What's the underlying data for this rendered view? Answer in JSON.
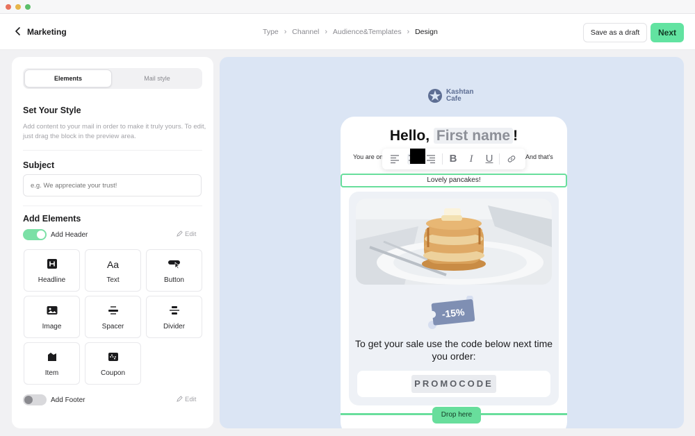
{
  "app": {
    "title": "Marketing"
  },
  "breadcrumb": {
    "items": [
      "Type",
      "Channel",
      "Audience&Templates",
      "Design"
    ],
    "active_index": 3
  },
  "toolbar": {
    "save_draft_label": "Save as a draft",
    "next_label": "Next"
  },
  "colors": {
    "accent": "#62e3a1",
    "preview_bg": "#dbe5f4",
    "logo": "#5d6e93",
    "coupon": "#7f8fb3"
  },
  "left_panel": {
    "tabs": [
      {
        "label": "Elements",
        "active": true
      },
      {
        "label": "Mail style",
        "active": false
      }
    ],
    "style_title": "Set Your Style",
    "style_desc": "Add content to your mail in order to make it truly yours. To edit, just drag the block in the preview area.",
    "subject_title": "Subject",
    "subject_placeholder": "e.g. We appreciate your trust!",
    "subject_value": "",
    "elements_title": "Add Elements",
    "header_toggle": {
      "label": "Add Header",
      "on": true,
      "edit_label": "Edit"
    },
    "footer_toggle": {
      "label": "Add Footer",
      "on": false,
      "edit_label": "Edit"
    },
    "elements": [
      {
        "label": "Headline",
        "icon": "headline-icon"
      },
      {
        "label": "Text",
        "icon": "text-icon",
        "glyph": "Aa"
      },
      {
        "label": "Button",
        "icon": "button-icon"
      },
      {
        "label": "Image",
        "icon": "image-icon"
      },
      {
        "label": "Spacer",
        "icon": "spacer-icon"
      },
      {
        "label": "Divider",
        "icon": "divider-icon"
      },
      {
        "label": "Item",
        "icon": "item-icon"
      },
      {
        "label": "Coupon",
        "icon": "coupon-icon"
      }
    ]
  },
  "preview": {
    "logo_line1": "Kashtan",
    "logo_line2": "Cafe",
    "greeting": "Hello,",
    "first_name_placeholder": "First name",
    "greeting_suffix": "!",
    "body_left": "You are on",
    "body_right": "And that's",
    "editing_text": "Lovely pancakes!",
    "format_toolbar": [
      "align-left-icon",
      "align-center-icon",
      "align-right-icon",
      "bold-icon",
      "italic-icon",
      "underline-icon",
      "link-icon"
    ],
    "discount_label": "-15%",
    "offer_text": "To get your sale use the code below next time you order:",
    "promo_code": "PROMOCODE",
    "drop_label": "Drop here"
  }
}
